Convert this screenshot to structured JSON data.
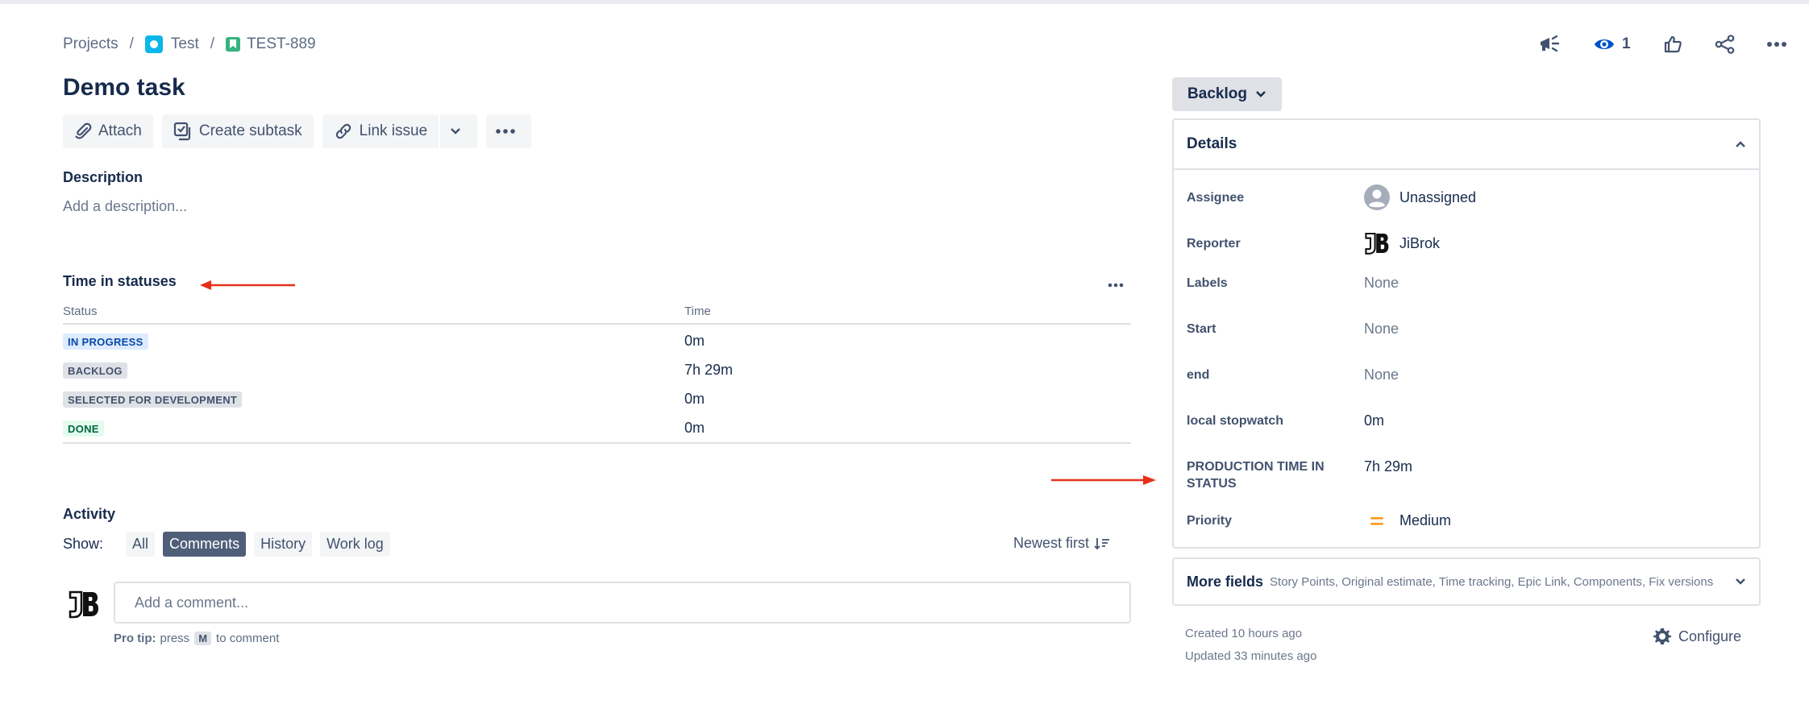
{
  "breadcrumb": {
    "projects": "Projects",
    "separator": "/",
    "project": "Test",
    "issue_key": "TEST-889"
  },
  "issue": {
    "title": "Demo task"
  },
  "toolbar": {
    "attach": "Attach",
    "create_subtask": "Create subtask",
    "link_issue": "Link issue"
  },
  "description": {
    "label": "Description",
    "placeholder": "Add a description..."
  },
  "time_in_statuses": {
    "title": "Time in statuses",
    "columns": [
      "Status",
      "Time"
    ],
    "rows": [
      {
        "status": "IN PROGRESS",
        "time": "0m",
        "color": "#deebff"
      },
      {
        "status": "BACKLOG",
        "time": "7h 29m",
        "color": "#dfe1e6"
      },
      {
        "status": "SELECTED FOR DEVELOPMENT",
        "time": "0m",
        "color": "#dfe1e6"
      },
      {
        "status": "DONE",
        "time": "0m",
        "color": "#e3fcef"
      }
    ]
  },
  "activity": {
    "title": "Activity",
    "show_label": "Show:",
    "filters": [
      {
        "label": "All",
        "active": false
      },
      {
        "label": "Comments",
        "active": true
      },
      {
        "label": "History",
        "active": false
      },
      {
        "label": "Work log",
        "active": false
      }
    ],
    "sort_label": "Newest first",
    "comment_placeholder": "Add a comment...",
    "pro_tip_label": "Pro tip:",
    "pro_tip_press": "press",
    "pro_tip_key": "M",
    "pro_tip_action": "to comment"
  },
  "header_actions": {
    "watchers_count": "1"
  },
  "status": {
    "label": "Backlog"
  },
  "details": {
    "title": "Details",
    "fields": [
      {
        "label": "Assignee",
        "value": "Unassigned"
      },
      {
        "label": "Reporter",
        "value": "JiBrok"
      },
      {
        "label": "Labels",
        "value": "None"
      },
      {
        "label": "Start",
        "value": "None"
      },
      {
        "label": "end",
        "value": "None"
      },
      {
        "label": "local stopwatch",
        "value": "0m"
      },
      {
        "label": "PRODUCTION TIME IN STATUS",
        "value": "7h 29m"
      },
      {
        "label": "Priority",
        "value": "Medium"
      }
    ]
  },
  "more_fields": {
    "title": "More fields",
    "list": "Story Points, Original estimate, Time tracking, Epic Link, Components, Fix versions"
  },
  "meta": {
    "created": "Created 10 hours ago",
    "updated": "Updated 33 minutes ago",
    "configure": "Configure"
  },
  "colors": {
    "accent_blue": "#0052cc",
    "annotation_red": "#e5301c",
    "priority_medium": "#ff991f"
  }
}
